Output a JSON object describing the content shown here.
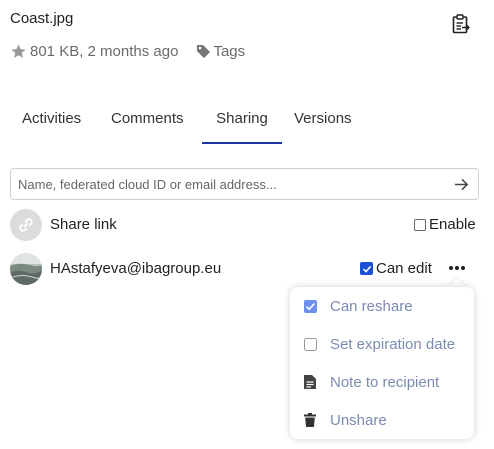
{
  "file": {
    "name": "Coast.jpg",
    "size_modified": "801 KB, 2 months ago",
    "tags_label": "Tags"
  },
  "tabs": [
    {
      "label": "Activities",
      "active": false
    },
    {
      "label": "Comments",
      "active": false
    },
    {
      "label": "Sharing",
      "active": true
    },
    {
      "label": "Versions",
      "active": false
    }
  ],
  "search": {
    "placeholder": "Name, federated cloud ID or email address..."
  },
  "share_link": {
    "label": "Share link",
    "enable_label": "Enable",
    "enabled": false
  },
  "share": {
    "user": "HAstafyeva@ibagroup.eu",
    "can_edit_label": "Can edit",
    "can_edit": true
  },
  "menu": {
    "items": [
      {
        "label": "Can reshare",
        "icon": "checkbox-checked-icon",
        "checked": true
      },
      {
        "label": "Set expiration date",
        "icon": "checkbox-empty-icon",
        "checked": false
      },
      {
        "label": "Note to recipient",
        "icon": "note-icon"
      },
      {
        "label": "Unshare",
        "icon": "trash-icon"
      }
    ]
  },
  "colors": {
    "accent": "#1b34a3",
    "checkbox": "#1b4fd6",
    "menu_text": "#7c8bb2"
  }
}
